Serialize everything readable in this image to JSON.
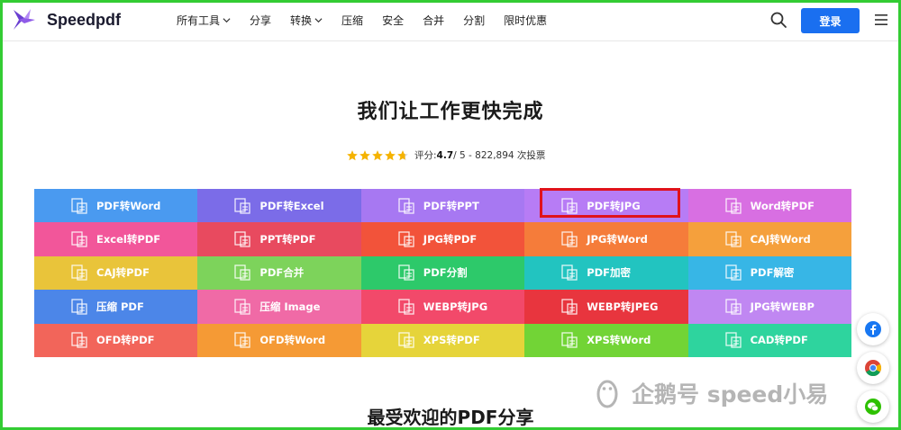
{
  "header": {
    "brand": "Speedpdf",
    "nav": [
      {
        "label": "所有工具",
        "dropdown": true
      },
      {
        "label": "分享",
        "dropdown": false
      },
      {
        "label": "转换",
        "dropdown": true
      },
      {
        "label": "压缩",
        "dropdown": false
      },
      {
        "label": "安全",
        "dropdown": false
      },
      {
        "label": "合并",
        "dropdown": false
      },
      {
        "label": "分割",
        "dropdown": false
      },
      {
        "label": "限时优惠",
        "dropdown": false
      }
    ],
    "login_label": "登录"
  },
  "hero": {
    "title": "我们让工作更快完成",
    "rating_label": "评分: ",
    "rating_value": "4.7",
    "rating_suffix": " / 5 - 822,894 次投票",
    "stars": 4.7
  },
  "tools": [
    {
      "label": "PDF转Word",
      "color": "#4a9af0"
    },
    {
      "label": "PDF转Excel",
      "color": "#7b6ce8"
    },
    {
      "label": "PDF转PPT",
      "color": "#a778f2"
    },
    {
      "label": "PDF转JPG",
      "color": "#b77cf5"
    },
    {
      "label": "Word转PDF",
      "color": "#d86fe2"
    },
    {
      "label": "Excel转PDF",
      "color": "#f2569a"
    },
    {
      "label": "PPT转PDF",
      "color": "#e84a5f"
    },
    {
      "label": "JPG转PDF",
      "color": "#f2533a"
    },
    {
      "label": "JPG转Word",
      "color": "#f57c3a"
    },
    {
      "label": "CAJ转Word",
      "color": "#f5a03c"
    },
    {
      "label": "CAJ转PDF",
      "color": "#e9c43a"
    },
    {
      "label": "PDF合并",
      "color": "#7dd35b"
    },
    {
      "label": "PDF分割",
      "color": "#2dc96a"
    },
    {
      "label": "PDF加密",
      "color": "#22c4c0"
    },
    {
      "label": "PDF解密",
      "color": "#37b6e6"
    },
    {
      "label": "压缩 PDF",
      "color": "#4c86e8"
    },
    {
      "label": "压缩 Image",
      "color": "#f06aa6"
    },
    {
      "label": "WEBP转JPG",
      "color": "#f2496a"
    },
    {
      "label": "WEBP转JPEG",
      "color": "#e8353e"
    },
    {
      "label": "JPG转WEBP",
      "color": "#c087f2"
    },
    {
      "label": "OFD转PDF",
      "color": "#f2655a"
    },
    {
      "label": "OFD转Word",
      "color": "#f59a35"
    },
    {
      "label": "XPS转PDF",
      "color": "#e6d43a"
    },
    {
      "label": "XPS转Word",
      "color": "#72d436"
    },
    {
      "label": "CAD转PDF",
      "color": "#2ed49e"
    }
  ],
  "section": {
    "title": "最受欢迎的PDF分享"
  },
  "watermark": {
    "text": "企鹅号 speed小易"
  },
  "side_icons": [
    "facebook-icon",
    "chrome-icon",
    "wechat-icon"
  ]
}
